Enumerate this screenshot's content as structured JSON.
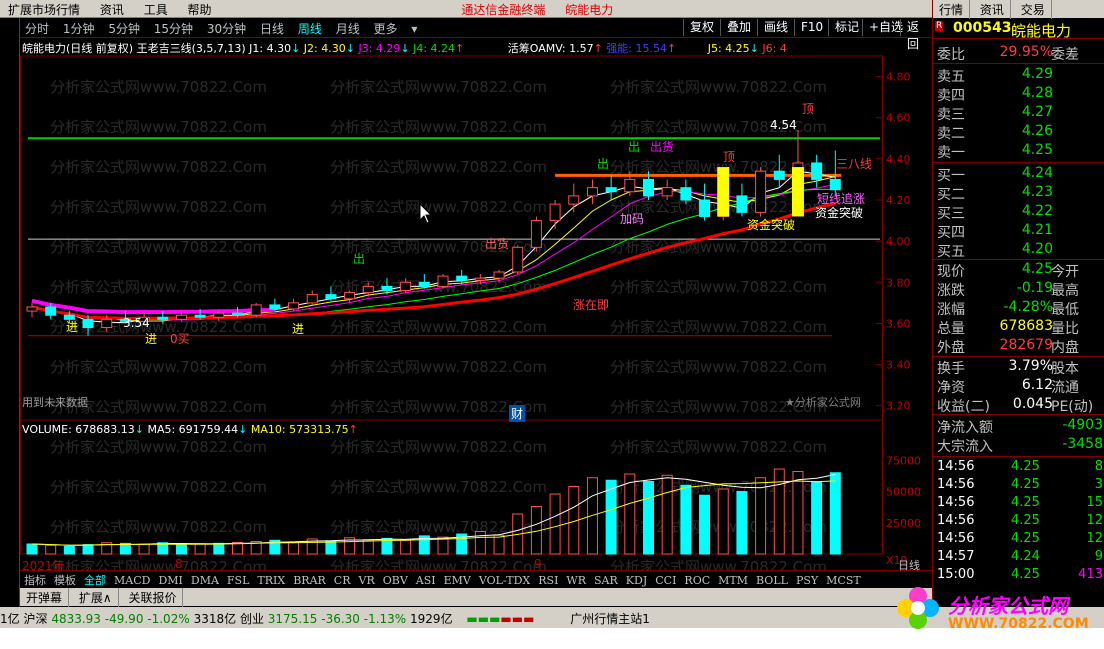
{
  "menubar": {
    "items": [
      "扩展市场行情",
      "资讯",
      "工具",
      "帮助"
    ],
    "center_1": "通达信金融终端",
    "center_2": "皖能电力"
  },
  "toolbar": {
    "periods": [
      "分时",
      "1分钟",
      "5分钟",
      "15分钟",
      "30分钟",
      "日线",
      "周线",
      "月线",
      "更多"
    ],
    "active": "日线",
    "right_buttons": [
      "复权",
      "叠加",
      "画线",
      "F10",
      "标记",
      "+自选",
      "返回"
    ]
  },
  "chart": {
    "info_title": "皖能电力(日线 前复权) 王老吉三线(3,5,7,13)",
    "j1": "J1: 4.30",
    "j2": "J2: 4.30",
    "j3": "J3: 4.29",
    "j4": "J4: 4.24",
    "oamv": "活筹OAMV: 1.57",
    "strength": "强能: 15.54",
    "j5": "J5: 4.25",
    "j6": "J6: 4",
    "future_data": "用到未来数据",
    "watermark_sig": "★分析家公式网",
    "price_axis": [
      "4.80",
      "4.60",
      "4.40",
      "4.20",
      "4.00",
      "3.80",
      "3.60",
      "3.40",
      "3.20"
    ],
    "vol_axis": [
      "75000",
      "50000",
      "25000",
      "X10"
    ],
    "vol_info": {
      "volume": "VOLUME: 678683.13",
      "ma5": "MA5: 691759.44",
      "ma10": "MA10: 573313.75"
    },
    "annotations": {
      "high": "4.54",
      "low": "3.54",
      "top1": "顶",
      "top2": "顶",
      "out1": "出",
      "out2": "出",
      "out3": "出",
      "out_goods1": "出货",
      "out_goods2": "出货",
      "sanba": "三八线",
      "short_chase": "短线追涨",
      "fund_break1": "资金突破",
      "fund_break2": "资金突破",
      "add_pos": "加码",
      "up_imm": "涨在即",
      "buy": "0买",
      "jin1": "进",
      "jin2": "进",
      "jin3": "进",
      "cai": "财",
      "ying_jin": "短线追涨"
    },
    "x_labels": {
      "year": "2021年",
      "m8": "8",
      "m9": "9"
    },
    "watermark": "分析家公式网www.70822.Com"
  },
  "chart_data": {
    "type": "candlestick",
    "title": "皖能电力(日线 前复权)",
    "ylim": [
      3.15,
      4.9
    ],
    "high": 4.54,
    "low": 3.54,
    "ohlc": [
      [
        3.66,
        3.7,
        3.63,
        3.68
      ],
      [
        3.68,
        3.7,
        3.62,
        3.64
      ],
      [
        3.64,
        3.66,
        3.6,
        3.62
      ],
      [
        3.62,
        3.64,
        3.54,
        3.58
      ],
      [
        3.58,
        3.64,
        3.56,
        3.62
      ],
      [
        3.62,
        3.66,
        3.6,
        3.61
      ],
      [
        3.61,
        3.65,
        3.59,
        3.63
      ],
      [
        3.63,
        3.66,
        3.6,
        3.62
      ],
      [
        3.62,
        3.66,
        3.61,
        3.64
      ],
      [
        3.64,
        3.67,
        3.62,
        3.63
      ],
      [
        3.63,
        3.66,
        3.61,
        3.65
      ],
      [
        3.65,
        3.68,
        3.63,
        3.64
      ],
      [
        3.64,
        3.7,
        3.63,
        3.69
      ],
      [
        3.69,
        3.72,
        3.66,
        3.67
      ],
      [
        3.67,
        3.72,
        3.66,
        3.7
      ],
      [
        3.7,
        3.76,
        3.69,
        3.74
      ],
      [
        3.74,
        3.78,
        3.71,
        3.72
      ],
      [
        3.72,
        3.76,
        3.7,
        3.75
      ],
      [
        3.75,
        3.8,
        3.73,
        3.78
      ],
      [
        3.78,
        3.82,
        3.74,
        3.76
      ],
      [
        3.76,
        3.82,
        3.75,
        3.8
      ],
      [
        3.8,
        3.84,
        3.77,
        3.78
      ],
      [
        3.78,
        3.84,
        3.77,
        3.83
      ],
      [
        3.83,
        3.86,
        3.79,
        3.81
      ],
      [
        3.81,
        3.84,
        3.79,
        3.82
      ],
      [
        3.82,
        3.86,
        3.8,
        3.85
      ],
      [
        3.85,
        3.98,
        3.84,
        3.97
      ],
      [
        3.97,
        4.12,
        3.95,
        4.1
      ],
      [
        4.1,
        4.2,
        4.06,
        4.18
      ],
      [
        4.18,
        4.28,
        4.14,
        4.22
      ],
      [
        4.22,
        4.3,
        4.18,
        4.26
      ],
      [
        4.26,
        4.32,
        4.2,
        4.24
      ],
      [
        4.24,
        4.34,
        4.22,
        4.3
      ],
      [
        4.3,
        4.34,
        4.2,
        4.22
      ],
      [
        4.22,
        4.3,
        4.2,
        4.26
      ],
      [
        4.26,
        4.3,
        4.18,
        4.2
      ],
      [
        4.2,
        4.28,
        4.1,
        4.12
      ],
      [
        4.12,
        4.24,
        4.1,
        4.22
      ],
      [
        4.22,
        4.28,
        4.12,
        4.14
      ],
      [
        4.14,
        4.36,
        4.12,
        4.34
      ],
      [
        4.34,
        4.42,
        4.26,
        4.3
      ],
      [
        4.3,
        4.54,
        4.28,
        4.38
      ],
      [
        4.38,
        4.42,
        4.26,
        4.3
      ],
      [
        4.3,
        4.44,
        4.22,
        4.25
      ]
    ],
    "volume_x10": [
      8000,
      7000,
      6000,
      7500,
      9000,
      8500,
      8000,
      9000,
      7500,
      8200,
      8500,
      9200,
      10000,
      11000,
      9500,
      12000,
      10500,
      13000,
      11500,
      12500,
      11000,
      14500,
      13500,
      16000,
      18000,
      15000,
      32000,
      38000,
      48000,
      54000,
      61000,
      59000,
      64000,
      58000,
      63000,
      55000,
      47000,
      52000,
      50000,
      61000,
      68000,
      66000,
      58000,
      65000
    ],
    "volume_color": [
      "c",
      "r",
      "c",
      "c",
      "r",
      "c",
      "r",
      "c",
      "c",
      "r",
      "c",
      "r",
      "r",
      "c",
      "r",
      "r",
      "c",
      "r",
      "r",
      "c",
      "r",
      "c",
      "r",
      "c",
      "r",
      "r",
      "r",
      "r",
      "r",
      "r",
      "r",
      "c",
      "r",
      "c",
      "r",
      "c",
      "c",
      "r",
      "c",
      "r",
      "r",
      "r",
      "c",
      "c"
    ],
    "volume": 678683.13,
    "ma5": 691759.44,
    "ma10": 573313.75
  },
  "idx_tabs": [
    "指标",
    "模板",
    "全部",
    "MACD",
    "DMI",
    "DMA",
    "FSL",
    "TRIX",
    "BRAR",
    "CR",
    "VR",
    "OBV",
    "ASI",
    "EMV",
    "VOL-TDX",
    "RSI",
    "WR",
    "SAR",
    "KDJ",
    "CCI",
    "ROC",
    "MTM",
    "BOLL",
    "PSY",
    "MCST"
  ],
  "idx_active": "全部",
  "idx_corner": "日线",
  "bottom_tabs": [
    "开弹幕",
    "扩展∧",
    "关联报价"
  ],
  "status": {
    "sh_label": "沪深",
    "sh_val": "4833.93",
    "sh_chg": "-49.90",
    "sh_pct": "-1.02%",
    "sh_amt": "3318亿",
    "cy_label": "创业",
    "cy_val": "3175.15",
    "cy_chg": "-36.30",
    "cy_pct": "-1.13%",
    "cy_amt": "1929亿",
    "server": "广州行情主站1",
    "left": "1亿"
  },
  "rpanel": {
    "top_tabs": [
      "行情",
      "资讯",
      "交易"
    ],
    "code": "000543",
    "name": "皖能电力",
    "weibi": {
      "label": "委比",
      "val": "29.95%",
      "label2": "委差"
    },
    "sell": [
      {
        "l": "卖五",
        "p": "4.29"
      },
      {
        "l": "卖四",
        "p": "4.28"
      },
      {
        "l": "卖三",
        "p": "4.27"
      },
      {
        "l": "卖二",
        "p": "4.26"
      },
      {
        "l": "卖一",
        "p": "4.25"
      }
    ],
    "buy": [
      {
        "l": "买一",
        "p": "4.24"
      },
      {
        "l": "买二",
        "p": "4.23"
      },
      {
        "l": "买三",
        "p": "4.22"
      },
      {
        "l": "买四",
        "p": "4.21"
      },
      {
        "l": "买五",
        "p": "4.20"
      }
    ],
    "stats": [
      {
        "l": "现价",
        "v": "4.25",
        "l2": "今开",
        "c": "green"
      },
      {
        "l": "涨跌",
        "v": "-0.19",
        "l2": "最高",
        "c": "green"
      },
      {
        "l": "涨幅",
        "v": "-4.28%",
        "l2": "最低",
        "c": "green"
      },
      {
        "l": "总量",
        "v": "678683",
        "l2": "量比",
        "c": "yellow"
      },
      {
        "l": "外盘",
        "v": "282679",
        "l2": "内盘",
        "c": "red"
      }
    ],
    "stats2": [
      {
        "l": "换手",
        "v": "3.79%",
        "l2": "股本"
      },
      {
        "l": "净资",
        "v": "6.12",
        "l2": "流通"
      },
      {
        "l": "收益(二)",
        "v": "0.045",
        "l2": "PE(动)"
      }
    ],
    "flow": [
      {
        "l": "净流入额",
        "v": "-4903"
      },
      {
        "l": "大宗流入",
        "v": "-3458"
      }
    ],
    "ticks": [
      {
        "t": "14:56",
        "p": "4.25",
        "v": "8",
        "c": "green"
      },
      {
        "t": "14:56",
        "p": "4.25",
        "v": "3",
        "c": "green"
      },
      {
        "t": "14:56",
        "p": "4.25",
        "v": "15",
        "c": "green"
      },
      {
        "t": "14:56",
        "p": "4.25",
        "v": "12",
        "c": "green"
      },
      {
        "t": "14:56",
        "p": "4.25",
        "v": "12",
        "c": "green"
      },
      {
        "t": "14:57",
        "p": "4.24",
        "v": "9",
        "c": "green"
      },
      {
        "t": "15:00",
        "p": "4.25",
        "v": "413",
        "c": "magenta"
      }
    ]
  },
  "logo": {
    "line1": "分析家公式网",
    "line2": "WWW.70822.COM"
  }
}
